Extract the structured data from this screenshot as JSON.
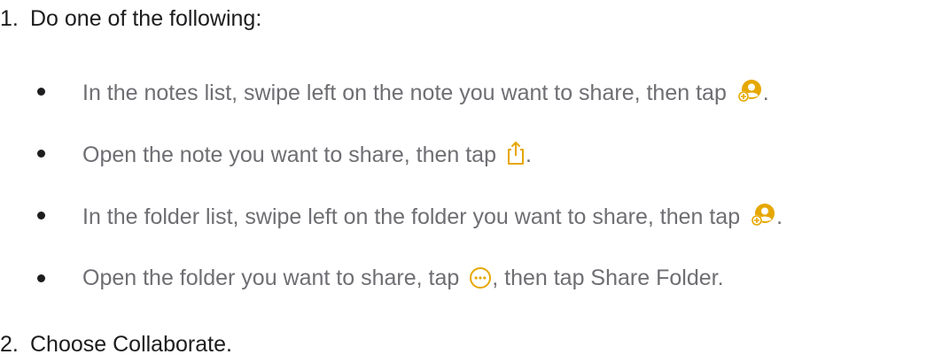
{
  "steps": [
    {
      "number": "1.",
      "text": "Do one of the following:",
      "bullets": [
        {
          "before": "In the notes list, swipe left on the note you want to share, then tap",
          "icon": "add-person-icon",
          "after": "."
        },
        {
          "before": "Open the note you want to share, then tap",
          "icon": "share-icon",
          "after": "."
        },
        {
          "before": "In the folder list, swipe left on the folder you want to share, then tap",
          "icon": "add-person-icon",
          "after": "."
        },
        {
          "before": "Open the folder you want to share, tap",
          "icon": "more-icon",
          "after": ", then tap Share Folder."
        }
      ]
    },
    {
      "number": "2.",
      "text": "Choose Collaborate."
    }
  ],
  "colors": {
    "text": "#1d1d1f",
    "bullet_text": "#6e6e73",
    "icon_accent": "#e6a700"
  }
}
